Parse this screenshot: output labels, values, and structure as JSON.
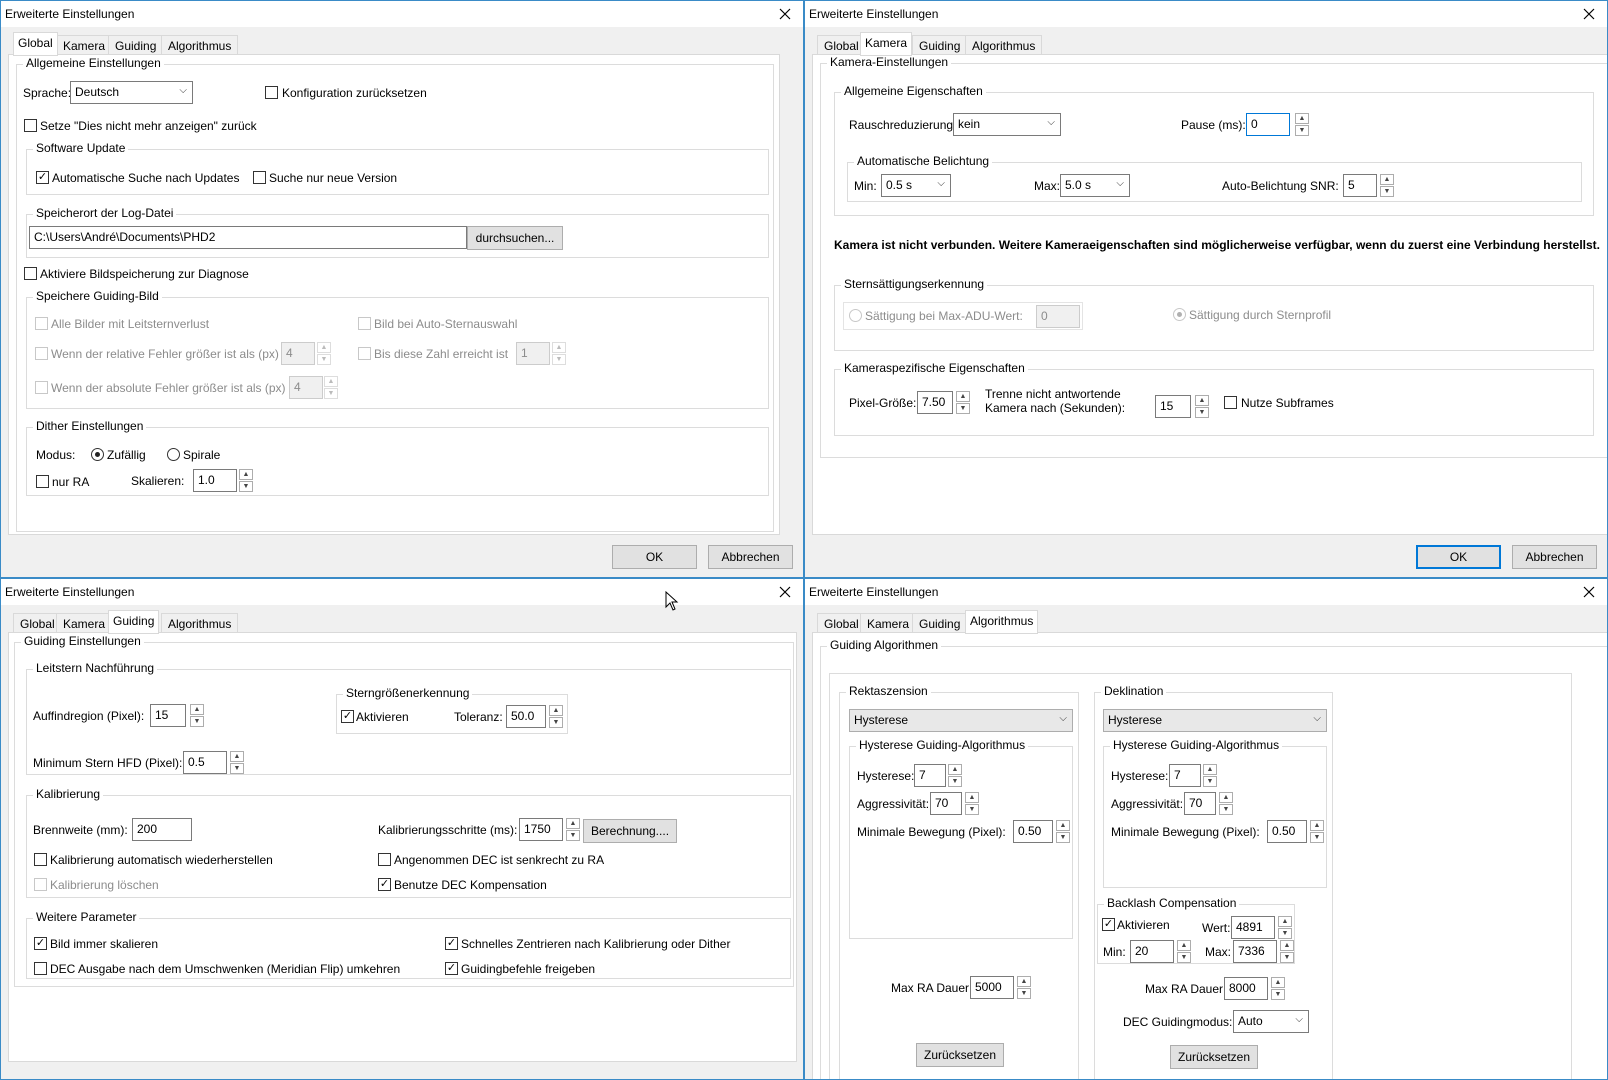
{
  "title": "Erweiterte Einstellungen",
  "tabs": [
    "Global",
    "Kamera",
    "Guiding",
    "Algorithmus"
  ],
  "buttons": {
    "ok": "OK",
    "cancel": "Abbrechen"
  },
  "global": {
    "general_title": "Allgemeine Einstellungen",
    "language_label": "Sprache:",
    "language_value": "Deutsch",
    "reset_config": "Konfiguration zurücksetzen",
    "reset_dontshow": "Setze \"Dies nicht mehr anzeigen\" zurück",
    "update_title": "Software Update",
    "auto_update": "Automatische Suche nach Updates",
    "only_new": "Suche nur neue Version",
    "log_title": "Speicherort der Log-Datei",
    "log_path": "C:\\Users\\André\\Documents\\PHD2",
    "browse": "durchsuchen...",
    "diag_images": "Aktiviere Bildspeicherung zur Diagnose",
    "save_guide_title": "Speichere Guiding-Bild",
    "all_frames": "Alle Bilder mit Leitsternverlust",
    "auto_select": "Bild bei Auto-Sternauswahl",
    "rel_err": "Wenn der relative Fehler größer ist als (px)",
    "rel_val": "4",
    "until_count": "Bis diese Zahl erreicht ist",
    "count_val": "1",
    "abs_err": "Wenn der absolute Fehler größer ist als (px)",
    "abs_val": "4",
    "dither_title": "Dither Einstellungen",
    "mode_label": "Modus:",
    "random": "Zufällig",
    "spiral": "Spirale",
    "ra_only": "nur RA",
    "scale_label": "Skalieren:",
    "scale_val": "1.0"
  },
  "camera": {
    "title": "Kamera-Einstellungen",
    "props_title": "Allgemeine Eigenschaften",
    "noise_label": "Rauschreduzierung:",
    "noise_val": "kein",
    "pause_label": "Pause (ms):",
    "pause_val": "0",
    "autoexp_title": "Automatische Belichtung",
    "min_label": "Min:",
    "min_val": "0.5 s",
    "max_label": "Max:",
    "max_val": "5.0 s",
    "snr_label": "Auto-Belichtung SNR:",
    "snr_val": "5",
    "notice": "Kamera ist nicht verbunden.  Weitere Kameraeigenschaften sind möglicherweise verfügbar, wenn du zuerst eine Verbindung herstellst.",
    "sat_title": "Sternsättigungserkennung",
    "sat_adu": "Sättigung bei Max-ADU-Wert:",
    "sat_adu_val": "0",
    "sat_profile": "Sättigung durch Sternprofil",
    "specific_title": "Kameraspezifische Eigenschaften",
    "pixel_label": "Pixel-Größe:",
    "pixel_val": "7.50",
    "timeout_label1": "Trenne nicht antwortende",
    "timeout_label2": "Kamera nach (Sekunden):",
    "timeout_val": "15",
    "subframes": "Nutze Subframes"
  },
  "guiding": {
    "title": "Guiding Einstellungen",
    "track_title": "Leitstern  Nachführung",
    "search_label": "Auffindregion (Pixel):",
    "search_val": "15",
    "mass_title": "Sterngrößenerkennung",
    "mass_enable": "Aktivieren",
    "tol_label": "Toleranz:",
    "tol_val": "50.0",
    "hfd_label": "Minimum Stern HFD (Pixel):",
    "hfd_val": "0.5",
    "cal_title": "Kalibrierung",
    "focal_label": "Brennweite (mm):",
    "focal_val": "200",
    "steps_label": "Kalibrierungsschritte (ms):",
    "steps_val": "1750",
    "calc_btn": "Berechnung....",
    "auto_restore": "Kalibrierung automatisch wiederherstellen",
    "assume_ortho": "Angenommen DEC ist senkrecht zu RA",
    "clear_cal": "Kalibrierung löschen",
    "dec_comp": "Benutze DEC Kompensation",
    "more_title": "Weitere Parameter",
    "always_scale": "Bild immer skalieren",
    "fast_center": "Schnelles Zentrieren nach Kalibrierung oder Dither",
    "reverse_dec": "DEC Ausgabe nach dem Umschwenken (Meridian Flip) umkehren",
    "enable_output": "Guidingbefehle freigeben"
  },
  "algo": {
    "title": "Guiding Algorithmen",
    "ra_title": "Rektaszension",
    "dec_title": "Deklination",
    "algo_val": "Hysterese",
    "hyst_title": "Hysterese Guiding-Algorithmus",
    "hyst_label": "Hysterese:",
    "hyst_val": "7",
    "aggr_label": "Aggressivität:",
    "aggr_val": "70",
    "minmove_label": "Minimale Bewegung (Pixel):",
    "minmove_val": "0.50",
    "max_ra_label": "Max RA Dauer:",
    "max_ra_val": "5000",
    "reset_btn": "Zurücksetzen",
    "backlash_title": "Backlash Compensation",
    "bl_enable": "Aktivieren",
    "bl_value_label": "Wert:",
    "bl_value": "4891",
    "bl_min_label": "Min:",
    "bl_min": "20",
    "bl_max_label": "Max:",
    "bl_max": "7336",
    "max_dec_label": "Max RA Dauer:",
    "max_dec_val": "8000",
    "dec_mode_label": "DEC Guidingmodus:",
    "dec_mode_val": "Auto"
  },
  "icons": {
    "close": "close-icon",
    "dropdown": "chevron-down-icon",
    "spin": "spin-arrows-icon",
    "cursor": "mouse-pointer-icon"
  }
}
